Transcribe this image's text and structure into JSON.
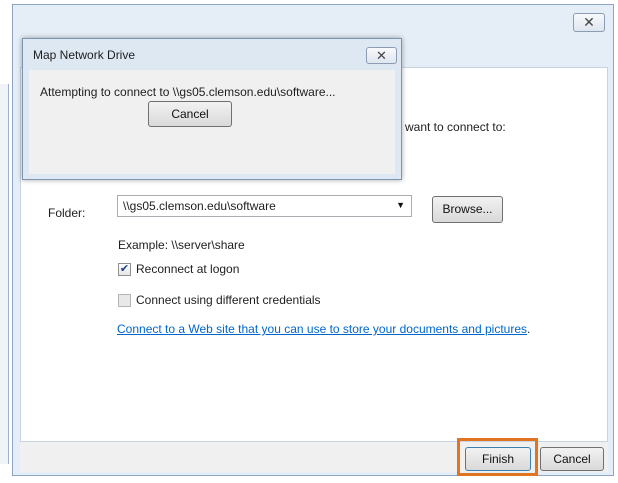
{
  "main_dialog": {
    "close_glyph": "✕",
    "prompt_tail": "want to connect to:",
    "folder_label": "Folder:",
    "folder_value": "\\\\gs05.clemson.edu\\software",
    "browse_label": "Browse...",
    "example_text": "Example: \\\\server\\share",
    "reconnect_label": "Reconnect at logon",
    "reconnect_checked": true,
    "credentials_label": "Connect using different credentials",
    "credentials_checked": false,
    "web_link": "Connect to a Web site that you can use to store your documents and pictures",
    "web_link_suffix": ".",
    "finish_label": "Finish",
    "cancel_label": "Cancel"
  },
  "progress_dialog": {
    "title": "Map Network Drive",
    "close_glyph": "✕",
    "message": "Attempting to connect to \\\\gs05.clemson.edu\\software...",
    "cancel_label": "Cancel"
  },
  "colors": {
    "highlight": "#e07421",
    "link": "#0066cc"
  },
  "icons": {
    "dropdown": "chevron-down-icon",
    "check": "checkmark-icon",
    "close": "close-icon"
  }
}
